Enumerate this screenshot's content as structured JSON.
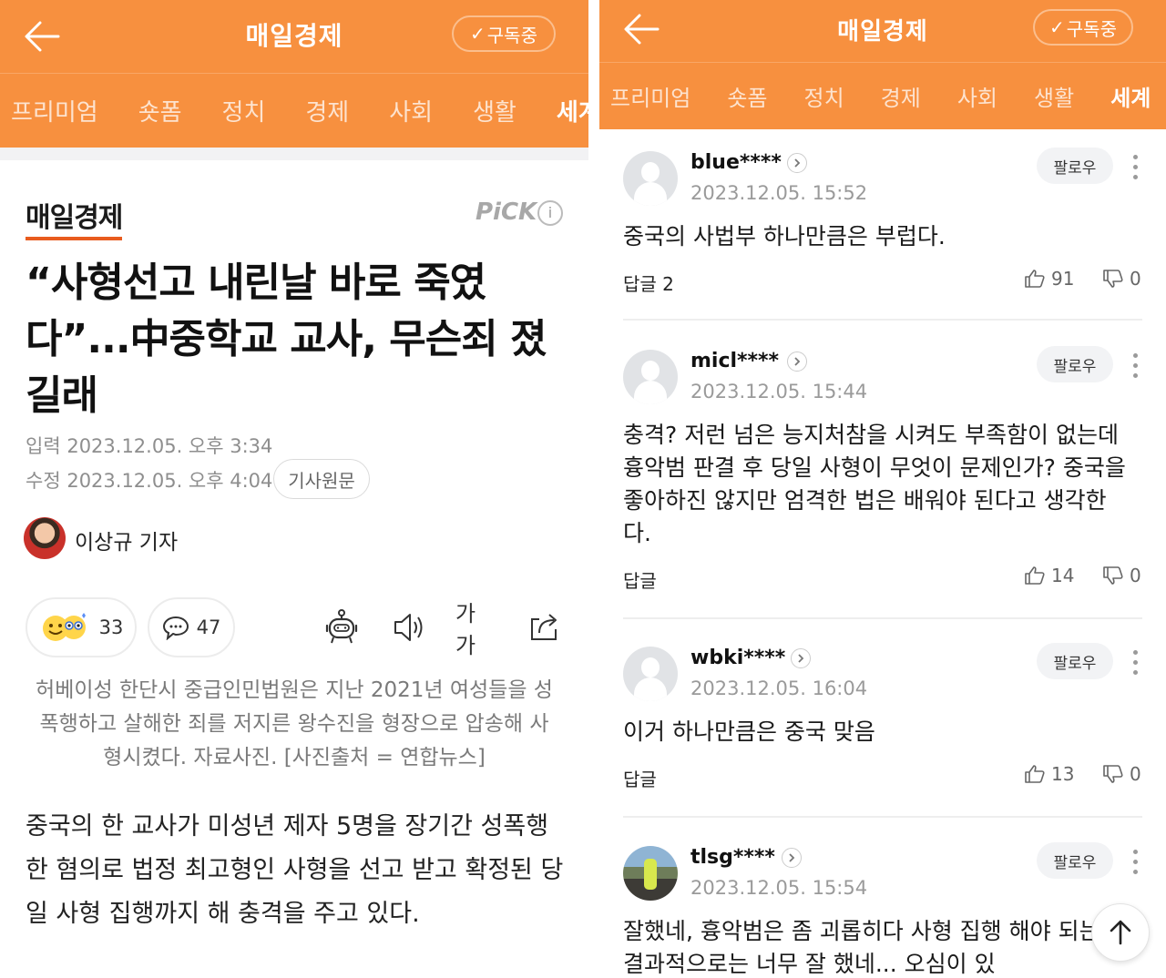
{
  "left": {
    "header": {
      "brand": "매일경제",
      "subscribe_label": "구독중"
    },
    "tabs": [
      "프리미엄",
      "숏폼",
      "정치",
      "경제",
      "사회",
      "생활",
      "세계"
    ],
    "article": {
      "press_logo": "매일경제",
      "pick_label": "PiCK",
      "info_label": "i",
      "headline": "“사형선고 내린날 바로 죽였다”...中중학교 교사, 무슨죄 졌길래",
      "input_label": "입력",
      "input_time": "2023.12.05. 오후 3:34",
      "edit_label": "수정",
      "edit_time": "2023.12.05. 오후 4:04",
      "original_button": "기사원문",
      "reporter": "이상규 기자",
      "reaction_count": "33",
      "comment_count": "47",
      "font_size_label": "가가",
      "caption": "허베이성 한단시 중급인민법원은 지난 2021년 여성들을 성폭행하고 살해한 죄를 저지른 왕수진을 형장으로 압송해 사형시켰다. 자료사진. [사진출처 = 연합뉴스]",
      "body": "중국의 한 교사가 미성년 제자 5명을 장기간 성폭행한 혐의로 법정 최고형인 사형을 선고 받고 확정된 당일 사형 집행까지 해 충격을 주고 있다."
    }
  },
  "right": {
    "header": {
      "brand": "매일경제",
      "subscribe_label": "구독중"
    },
    "tabs": [
      "프리미엄",
      "숏폼",
      "정치",
      "경제",
      "사회",
      "생활",
      "세계"
    ],
    "follow_label": "팔로우",
    "comments": [
      {
        "user": "blue****",
        "date": "2023.12.05. 15:52",
        "text": "중국의 사법부 하나만큼은 부럽다.",
        "reply": "답글 2",
        "likes": "91",
        "dislikes": "0"
      },
      {
        "user": "micl****",
        "date": "2023.12.05. 15:44",
        "text": "충격? 저런 넘은 능지처참을 시켜도 부족함이 없는데 흉악범 판결 후 당일 사형이 무엇이 문제인가? 중국을 좋아하진 않지만 엄격한 법은 배워야 된다고 생각한다.",
        "reply": "답글",
        "likes": "14",
        "dislikes": "0"
      },
      {
        "user": "wbki****",
        "date": "2023.12.05. 16:04",
        "text": "이거 하나만큼은 중국 맞음",
        "reply": "답글",
        "likes": "13",
        "dislikes": "0"
      },
      {
        "user": "tlsg****",
        "date": "2023.12.05. 15:54",
        "text": "잘했네, 흉악범은 좀 괴롭히다 사형 집행 해야 되는데 결과적으로는 너무 잘 했네... 오심이 있"
      }
    ]
  },
  "colors": {
    "brand_orange": "#f7903f",
    "pick_gray": "#a8a8a8"
  }
}
